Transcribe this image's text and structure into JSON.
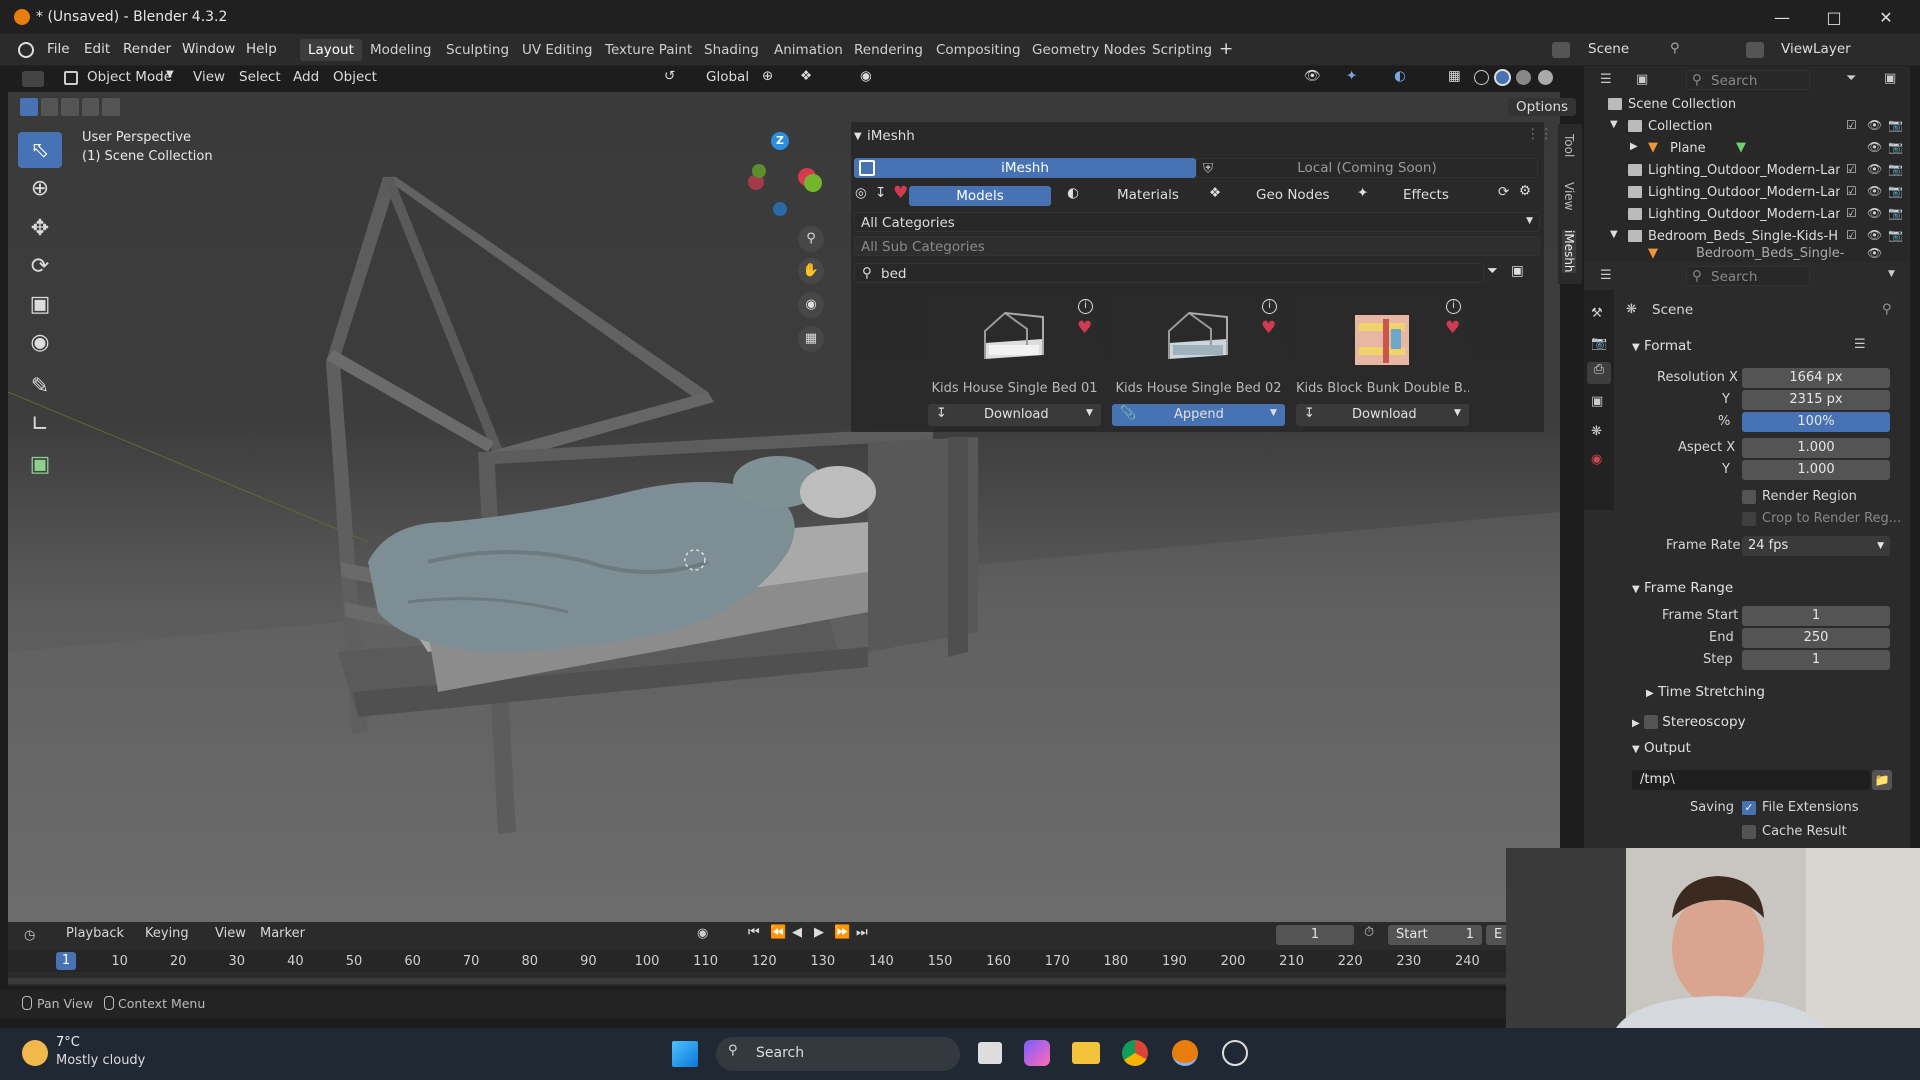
{
  "window": {
    "title": "* (Unsaved) - Blender 4.3.2"
  },
  "menu": [
    "File",
    "Edit",
    "Render",
    "Window",
    "Help"
  ],
  "workspaces": [
    "Layout",
    "Modeling",
    "Sculpting",
    "UV Editing",
    "Texture Paint",
    "Shading",
    "Animation",
    "Rendering",
    "Compositing",
    "Geometry Nodes",
    "Scripting"
  ],
  "active_workspace": "Layout",
  "topright": {
    "scene": "Scene",
    "view_layer": "ViewLayer"
  },
  "viewport_header": {
    "mode": "Object Mode",
    "menus": [
      "View",
      "Select",
      "Add",
      "Object"
    ],
    "transform": "Global",
    "options": "Options"
  },
  "viewport_overlay": {
    "line1": "User Perspective",
    "line2": "(1) Scene Collection"
  },
  "gizmo": {
    "z": "Z"
  },
  "imeshh": {
    "panel_title": "iMeshh",
    "tab_main": "iMeshh",
    "tab_local": "Local (Coming Soon)",
    "categories": [
      "Models",
      "Materials",
      "Geo Nodes",
      "Effects"
    ],
    "category_select": "All Categories",
    "subcategory_select": "All Sub Categories",
    "search_value": "bed",
    "assets": [
      {
        "name": "Kids House Single Bed 01",
        "action": "Download"
      },
      {
        "name": "Kids House Single Bed 02",
        "action": "Append"
      },
      {
        "name": "Kids Block Bunk Double B...",
        "action": "Download"
      }
    ]
  },
  "side_tabs": [
    "Tool",
    "View",
    "iMeshh"
  ],
  "outliner": {
    "search_placeholder": "Search",
    "rows": [
      {
        "label": "Scene Collection",
        "indent": 0
      },
      {
        "label": "Collection",
        "indent": 1
      },
      {
        "label": "Plane",
        "indent": 2
      },
      {
        "label": "Lighting_Outdoor_Modern-Lan",
        "indent": 1
      },
      {
        "label": "Lighting_Outdoor_Modern-Lan",
        "indent": 1
      },
      {
        "label": "Lighting_Outdoor_Modern-Lan",
        "indent": 1
      },
      {
        "label": "Bedroom_Beds_Single-Kids-H",
        "indent": 1
      },
      {
        "label": "Bedroom_Beds_Single-",
        "indent": 2
      }
    ]
  },
  "properties": {
    "search_placeholder": "Search",
    "context": "Scene",
    "format_title": "Format",
    "resolution_x_label": "Resolution X",
    "resolution_x": "1664 px",
    "y_label": "Y",
    "resolution_y": "2315 px",
    "percent_label": "%",
    "percent": "100%",
    "aspect_x_label": "Aspect X",
    "aspect_x": "1.000",
    "aspect_y": "1.000",
    "render_region": "Render Region",
    "crop": "Crop to Render Reg...",
    "frame_rate_label": "Frame Rate",
    "frame_rate": "24 fps",
    "frame_range_title": "Frame Range",
    "frame_start_label": "Frame Start",
    "frame_start": "1",
    "end_label": "End",
    "frame_end": "250",
    "step_label": "Step",
    "step": "1",
    "time_stretching": "Time Stretching",
    "stereoscopy": "Stereoscopy",
    "output_title": "Output",
    "output_path": "/tmp\\",
    "saving_label": "Saving",
    "file_extensions": "File Extensions",
    "cache_result": "Cache Result"
  },
  "timeline": {
    "menus": [
      "Playback",
      "Keying",
      "View",
      "Marker"
    ],
    "current_frame": "1",
    "start_label": "Start",
    "start": "1",
    "end_label": "E",
    "ticks": [
      "1",
      "10",
      "20",
      "30",
      "40",
      "50",
      "60",
      "70",
      "80",
      "90",
      "100",
      "110",
      "120",
      "130",
      "140",
      "150",
      "160",
      "170",
      "180",
      "190",
      "200",
      "210",
      "220",
      "230",
      "240"
    ]
  },
  "statusbar": {
    "pan": "Pan View",
    "context": "Context Menu"
  },
  "taskbar": {
    "temp": "7°C",
    "weather": "Mostly cloudy",
    "search": "Search"
  },
  "colors": {
    "accent": "#4772b3",
    "heart": "#d23b4f",
    "bg": "#2b2b2b"
  }
}
